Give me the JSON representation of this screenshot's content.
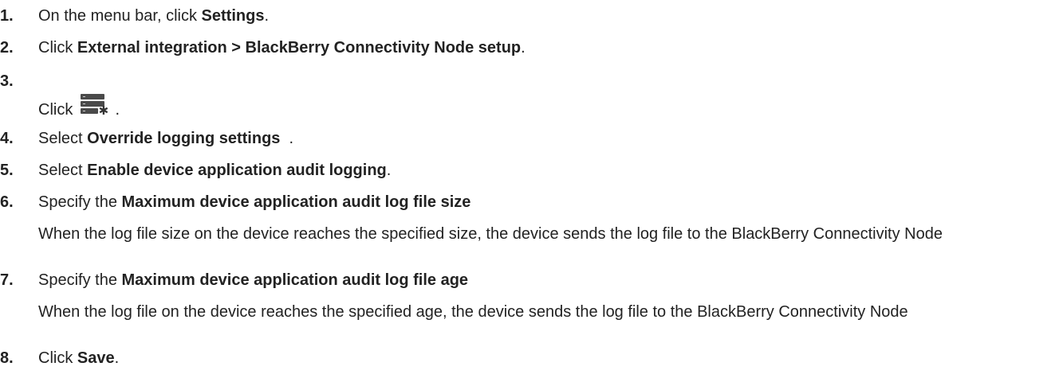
{
  "steps": [
    {
      "number": "1.",
      "parts": {
        "pre": "On the menu bar, click ",
        "bold": "Settings",
        "post": "."
      }
    },
    {
      "number": "2.",
      "parts": {
        "pre": "Click ",
        "bold": "External integration > BlackBerry Connectivity Node setup",
        "post": "."
      }
    },
    {
      "number": "3.",
      "parts": {
        "pre": "Click ",
        "post": " ."
      },
      "icon": "server-settings-icon"
    },
    {
      "number": "4.",
      "parts": {
        "pre": "Select ",
        "bold": "Override logging settings",
        "post": "  ."
      }
    },
    {
      "number": "5.",
      "parts": {
        "pre": "Select ",
        "bold": "Enable device application audit logging",
        "post": "."
      }
    },
    {
      "number": "6.",
      "parts": {
        "pre": "Specify the ",
        "bold": "Maximum device application audit log file size"
      },
      "sub": "When the log file size on the device reaches the specified size, the device sends the log file to the BlackBerry Connectivity Node"
    },
    {
      "number": "7.",
      "parts": {
        "pre": "Specify the ",
        "bold": "Maximum device application audit log file age"
      },
      "sub": "When the log file on the device reaches the specified age, the device sends the log file to the BlackBerry Connectivity Node"
    },
    {
      "number": "8.",
      "parts": {
        "pre": "Click ",
        "bold": "Save",
        "post": "."
      }
    }
  ]
}
